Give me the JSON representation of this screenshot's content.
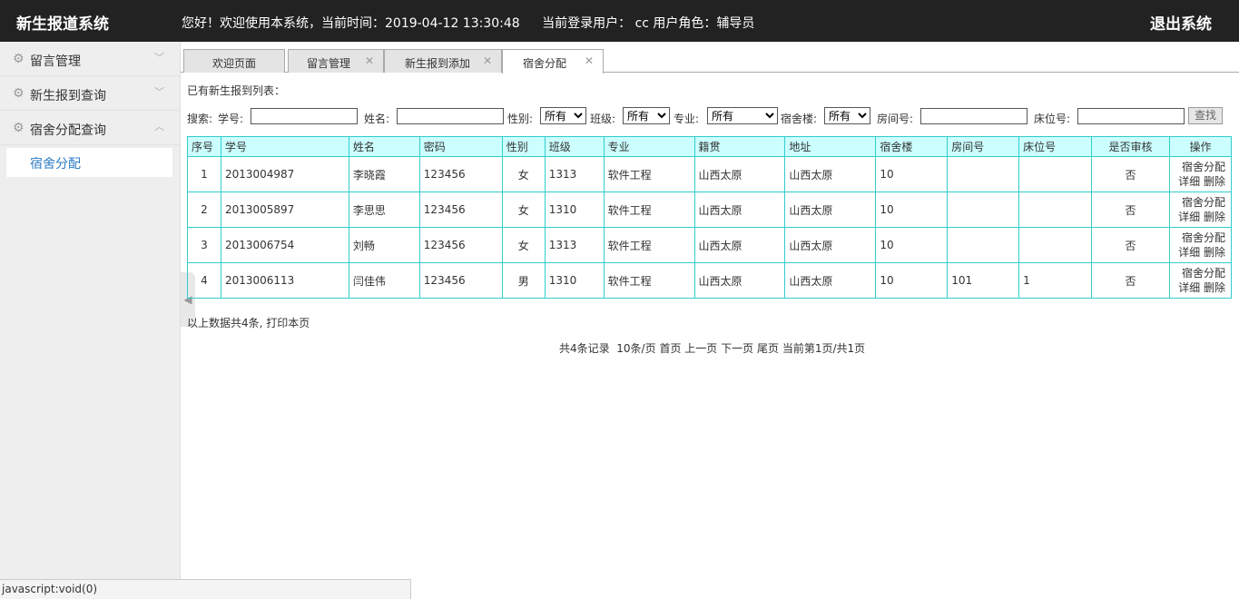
{
  "header": {
    "logo": "新生报道系统",
    "welcome": "您好！欢迎使用本系统，当前时间：2019-04-12 13:30:48",
    "user": "当前登录用户： cc  用户角色：辅导员",
    "logout": "退出系统"
  },
  "sidebar": {
    "items": [
      {
        "label": "留言管理",
        "chevron": "chevron-down-icon"
      },
      {
        "label": "新生报到查询",
        "chevron": "chevron-down-icon"
      },
      {
        "label": "宿舍分配查询",
        "chevron": "chevron-up-icon"
      }
    ],
    "submenu": [
      "宿舍分配"
    ]
  },
  "tabs": [
    {
      "label": "欢迎页面",
      "closable": false
    },
    {
      "label": "留言管理",
      "closable": true
    },
    {
      "label": "新生报到添加",
      "closable": true
    },
    {
      "label": "宿舍分配",
      "closable": true,
      "active": true
    }
  ],
  "list_title": "已有新生报到列表：",
  "search": {
    "label": "搜索:",
    "xuehao": "学号:",
    "xingming": "姓名:",
    "xingbie": "性别:",
    "xingbie_value": "所有",
    "banji": "班级:",
    "banji_value": "所有",
    "zhuanye": "专业:",
    "zhuanye_value": "所有",
    "sushelou": "宿舍楼:",
    "sushelou_value": "所有",
    "fangjian": "房间号:",
    "chuangwei": "床位号:",
    "button": "查找"
  },
  "table": {
    "headers": [
      "序号",
      "学号",
      "姓名",
      "密码",
      "性别",
      "班级",
      "专业",
      "籍贯",
      "地址",
      "宿舍楼",
      "房间号",
      "床位号",
      "是否审核",
      "操作"
    ],
    "rows": [
      [
        "1",
        "2013004987",
        "李晓霞",
        "123456",
        "女",
        "1313",
        "软件工程",
        "山西太原",
        "山西太原",
        "10",
        "",
        "",
        "否"
      ],
      [
        "2",
        "2013005897",
        "李思思",
        "123456",
        "女",
        "1310",
        "软件工程",
        "山西太原",
        "山西太原",
        "10",
        "",
        "",
        "否"
      ],
      [
        "3",
        "2013006754",
        "刘畅",
        "123456",
        "女",
        "1313",
        "软件工程",
        "山西太原",
        "山西太原",
        "10",
        "",
        "",
        "否"
      ],
      [
        "4",
        "2013006113",
        "闫佳伟",
        "123456",
        "男",
        "1310",
        "软件工程",
        "山西太原",
        "山西太原",
        "10",
        "101",
        "1",
        "否"
      ]
    ],
    "op_assign": "宿舍分配",
    "op_detail": "详细",
    "op_delete": "删除"
  },
  "summary": {
    "text": "以上数据共4条,",
    "print": "打印本页"
  },
  "pager": {
    "total": "共4条记录",
    "per_page": "10条/页",
    "first": "首页",
    "prev": "上一页",
    "next": "下一页",
    "last": "尾页",
    "current_prefix": "当前第",
    "current_page": "1",
    "current_mid": "页/共",
    "total_pages": "1",
    "current_suffix": "页"
  },
  "statusbar": "javascript:void(0)"
}
